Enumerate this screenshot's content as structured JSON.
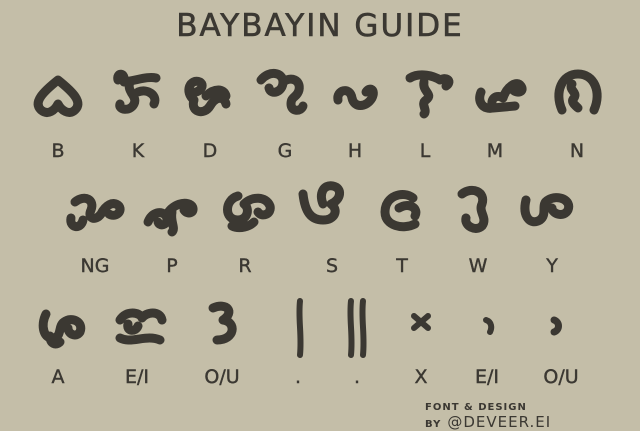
{
  "title": "BAYBAYIN GUIDE",
  "colors": {
    "background": "#c4bea8",
    "ink": "#3b3832"
  },
  "rows": [
    {
      "labels": [
        "B",
        "K",
        "D",
        "G",
        "H",
        "L",
        "M",
        "N"
      ],
      "glyph_icons": [
        "baybayin-ba-icon",
        "baybayin-ka-icon",
        "baybayin-da-icon",
        "baybayin-ga-icon",
        "baybayin-ha-icon",
        "baybayin-la-icon",
        "baybayin-ma-icon",
        "baybayin-na-icon"
      ]
    },
    {
      "labels": [
        "NG",
        "P",
        "R",
        "S",
        "T",
        "W",
        "Y"
      ],
      "glyph_icons": [
        "baybayin-nga-icon",
        "baybayin-pa-icon",
        "baybayin-ra-icon",
        "baybayin-sa-icon",
        "baybayin-ta-icon",
        "baybayin-wa-icon",
        "baybayin-ya-icon"
      ]
    },
    {
      "labels": [
        "A",
        "E/I",
        "O/U",
        ".",
        ".",
        "X",
        "E/I",
        "O/U"
      ],
      "glyph_icons": [
        "baybayin-a-icon",
        "baybayin-e-i-icon",
        "baybayin-o-u-icon",
        "single-danda-icon",
        "double-danda-icon",
        "virama-cross-icon",
        "kudlit-above-icon",
        "kudlit-below-icon"
      ]
    }
  ],
  "credit": {
    "text": "FONT & DESIGN BY",
    "handle": "@DEVEER.EI"
  }
}
